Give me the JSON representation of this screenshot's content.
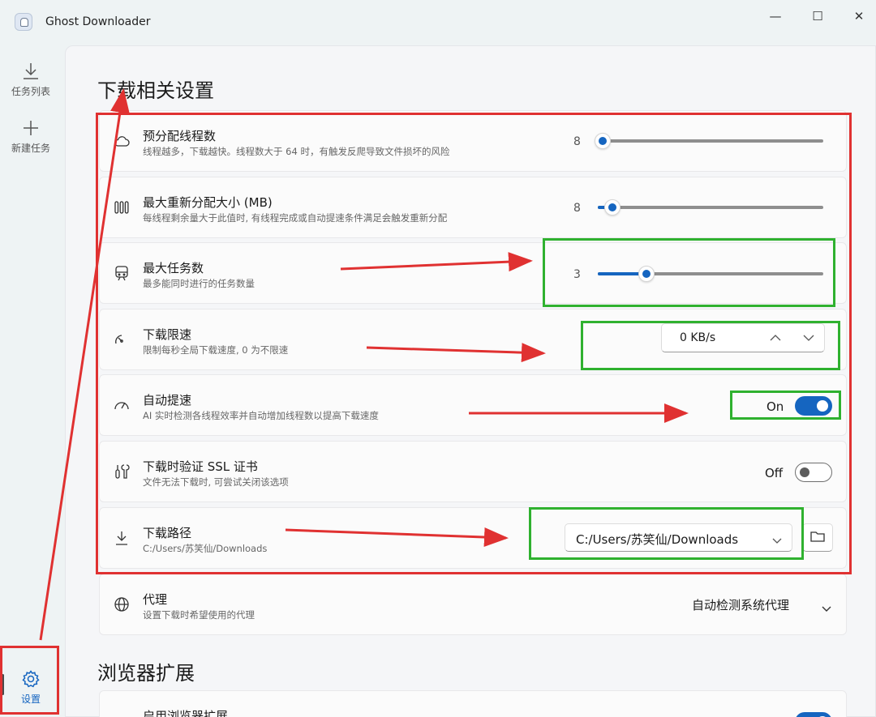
{
  "window": {
    "title": "Ghost Downloader",
    "minimize": "—",
    "maximize": "☐",
    "close": "✕"
  },
  "nav": {
    "items": [
      {
        "label": "任务列表",
        "icon": "download-icon"
      },
      {
        "label": "新建任务",
        "icon": "plus-icon"
      }
    ],
    "settings": {
      "label": "设置",
      "icon": "gear-icon"
    }
  },
  "sections": {
    "download": "下载相关设置",
    "browser": "浏览器扩展"
  },
  "settings": {
    "threads": {
      "title": "预分配线程数",
      "desc": "线程越多，下载越快。线程数大于 64 时，有触发反爬导致文件损坏的风险",
      "value": "8",
      "level": 0.0
    },
    "max_realloc": {
      "title": "最大重新分配大小 (MB)",
      "desc": "每线程剩余量大于此值时, 有线程完成或自动提速条件满足会触发重新分配",
      "value": "8",
      "level": 0.02
    },
    "max_tasks": {
      "title": "最大任务数",
      "desc": "最多能同时进行的任务数量",
      "value": "3",
      "level": 0.2
    },
    "speed_limit": {
      "title": "下载限速",
      "desc": "限制每秒全局下载速度, 0 为不限速",
      "value": "0 KB/s"
    },
    "auto_speedup": {
      "title": "自动提速",
      "desc": "AI 实时检测各线程效率并自动增加线程数以提高下载速度",
      "state": "On"
    },
    "ssl_verify": {
      "title": "下载时验证 SSL 证书",
      "desc": "文件无法下载时, 可尝试关闭该选项",
      "state": "Off"
    },
    "download_path": {
      "title": "下载路径",
      "desc": "C:/Users/苏笑仙/Downloads",
      "value": "C:/Users/苏笑仙/Downloads"
    },
    "proxy": {
      "title": "代理",
      "desc": "设置下载时希望使用的代理",
      "value": "自动检测系统代理"
    },
    "browser_ext": {
      "title": "启用浏览器扩展"
    }
  },
  "colors": {
    "accent": "#1565c0",
    "annotation_red": "#e03131",
    "annotation_green": "#2fb12f"
  }
}
